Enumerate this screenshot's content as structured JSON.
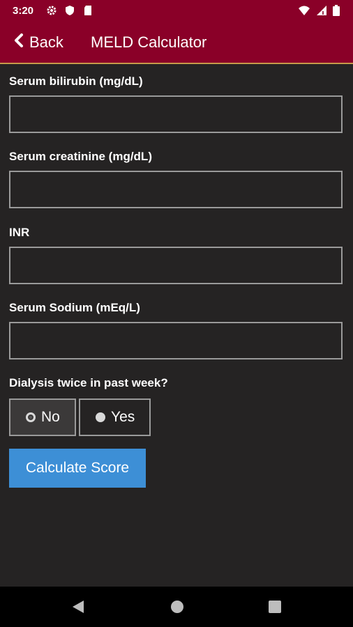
{
  "status_bar": {
    "time": "3:20"
  },
  "app_bar": {
    "back_label": "Back",
    "title": "MELD Calculator"
  },
  "form": {
    "fields": [
      {
        "label": "Serum bilirubin (mg/dL)",
        "value": "",
        "placeholder": ""
      },
      {
        "label": "Serum creatinine (mg/dL)",
        "value": "",
        "placeholder": ""
      },
      {
        "label": "INR",
        "value": "",
        "placeholder": ""
      },
      {
        "label": "Serum Sodium (mEq/L)",
        "value": "",
        "placeholder": ""
      }
    ],
    "dialysis": {
      "label": "Dialysis twice in past week?",
      "options": [
        {
          "label": "No",
          "selected": true
        },
        {
          "label": "Yes",
          "selected": false
        }
      ]
    },
    "calculate_label": "Calculate Score"
  },
  "colors": {
    "app_bar": "#8a0028",
    "accent_line": "#c79a4a",
    "button": "#3d8fd6",
    "background": "#252323"
  }
}
